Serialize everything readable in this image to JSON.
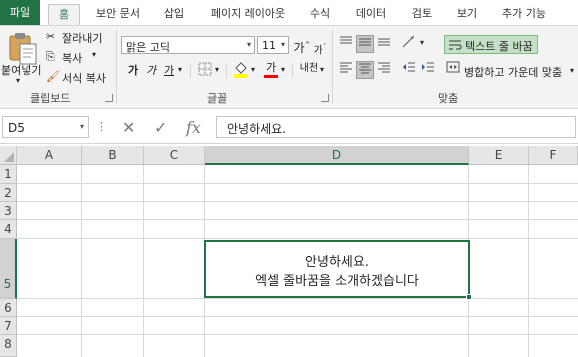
{
  "tabs": {
    "file": "파일",
    "home": "홈",
    "security": "보안 문서",
    "insert": "삽입",
    "layout": "페이지 레이아웃",
    "formulas": "수식",
    "data": "데이터",
    "review": "검토",
    "view": "보기",
    "addins": "추가 기능"
  },
  "clipboard": {
    "paste": "붙여넣기",
    "cut": "잘라내기",
    "copy": "복사",
    "format_painter": "서식 복사",
    "group_label": "클립보드"
  },
  "font": {
    "name": "맑은 고딕",
    "size": "11",
    "grow": "가",
    "shrink": "가",
    "bold": "가",
    "italic": "가",
    "underline": "가",
    "font_color_glyph": "가",
    "phonetic": "내천",
    "group_label": "글꼴"
  },
  "alignment": {
    "wrap_text": "텍스트 줄 바꿈",
    "merge_center": "병합하고 가운데 맞춤",
    "group_label": "맞춤"
  },
  "formula_bar": {
    "name_box": "D5",
    "cancel": "✕",
    "enter": "✓",
    "fx": "fx",
    "content": "안녕하세요."
  },
  "grid": {
    "columns": [
      "A",
      "B",
      "C",
      "D",
      "E",
      "F"
    ],
    "rows": [
      "1",
      "2",
      "3",
      "4",
      "5",
      "6",
      "7",
      "8"
    ],
    "selected_column": "D",
    "selected_row": "5",
    "active_cell": {
      "line1": "안녕하세요.",
      "line2": "엑셀 줄바꿈을 소개하겠습니다"
    }
  },
  "colors": {
    "accent": "#217346",
    "wrap_highlight": "#c5e0c9",
    "fill_color_bar": "#ffff00",
    "font_color_bar": "#ff0000"
  }
}
